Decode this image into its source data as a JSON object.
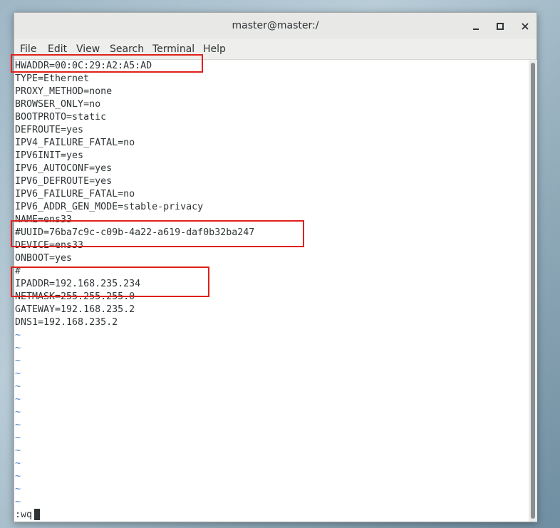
{
  "window": {
    "title": "master@master:/"
  },
  "menu": [
    "File",
    "Edit",
    "View",
    "Search",
    "Terminal",
    "Help"
  ],
  "lines": [
    "HWADDR=00:0C:29:A2:A5:AD",
    "TYPE=Ethernet",
    "PROXY_METHOD=none",
    "BROWSER_ONLY=no",
    "BOOTPROTO=static",
    "DEFROUTE=yes",
    "IPV4_FAILURE_FATAL=no",
    "IPV6INIT=yes",
    "IPV6_AUTOCONF=yes",
    "IPV6_DEFROUTE=yes",
    "IPV6_FAILURE_FATAL=no",
    "IPV6_ADDR_GEN_MODE=stable-privacy",
    "NAME=ens33",
    "#UUID=76ba7c9c-c09b-4a22-a619-daf0b32ba247",
    "DEVICE=ens33",
    "ONBOOT=yes",
    "#",
    "IPADDR=192.168.235.234",
    "NETMASK=255.255.255.0",
    "GATEWAY=192.168.235.2",
    "DNS1=192.168.235.2"
  ],
  "tildes": [
    "~",
    "~",
    "~",
    "~",
    "~",
    "~",
    "~",
    "~",
    "~",
    "~",
    "~",
    "~",
    "~",
    "~"
  ],
  "command": ":wq",
  "colors": {
    "highlight": "#e0201b",
    "tilde": "#4a7fc1",
    "text": "#2e3436"
  }
}
